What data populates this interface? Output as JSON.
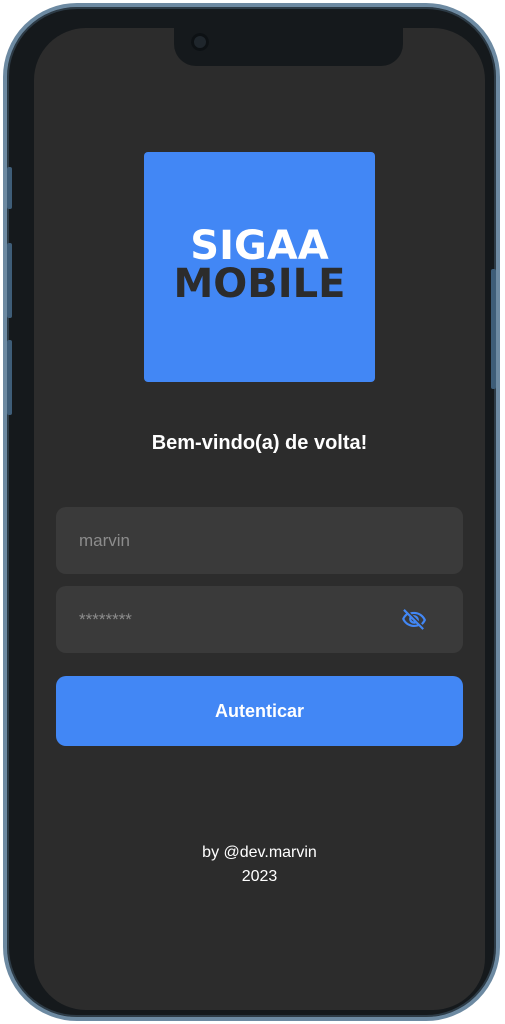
{
  "logo": {
    "line1": "SIGAA",
    "line2": "MOBILE",
    "background_color": "#4287f5"
  },
  "welcome_text": "Bem-vindo(a) de volta!",
  "form": {
    "username_value": "marvin",
    "password_value": "********",
    "password_toggle_icon": "eye-off-icon",
    "submit_label": "Autenticar",
    "accent_color": "#4287f5"
  },
  "footer": {
    "author": "by @dev.marvin",
    "year": "2023"
  }
}
